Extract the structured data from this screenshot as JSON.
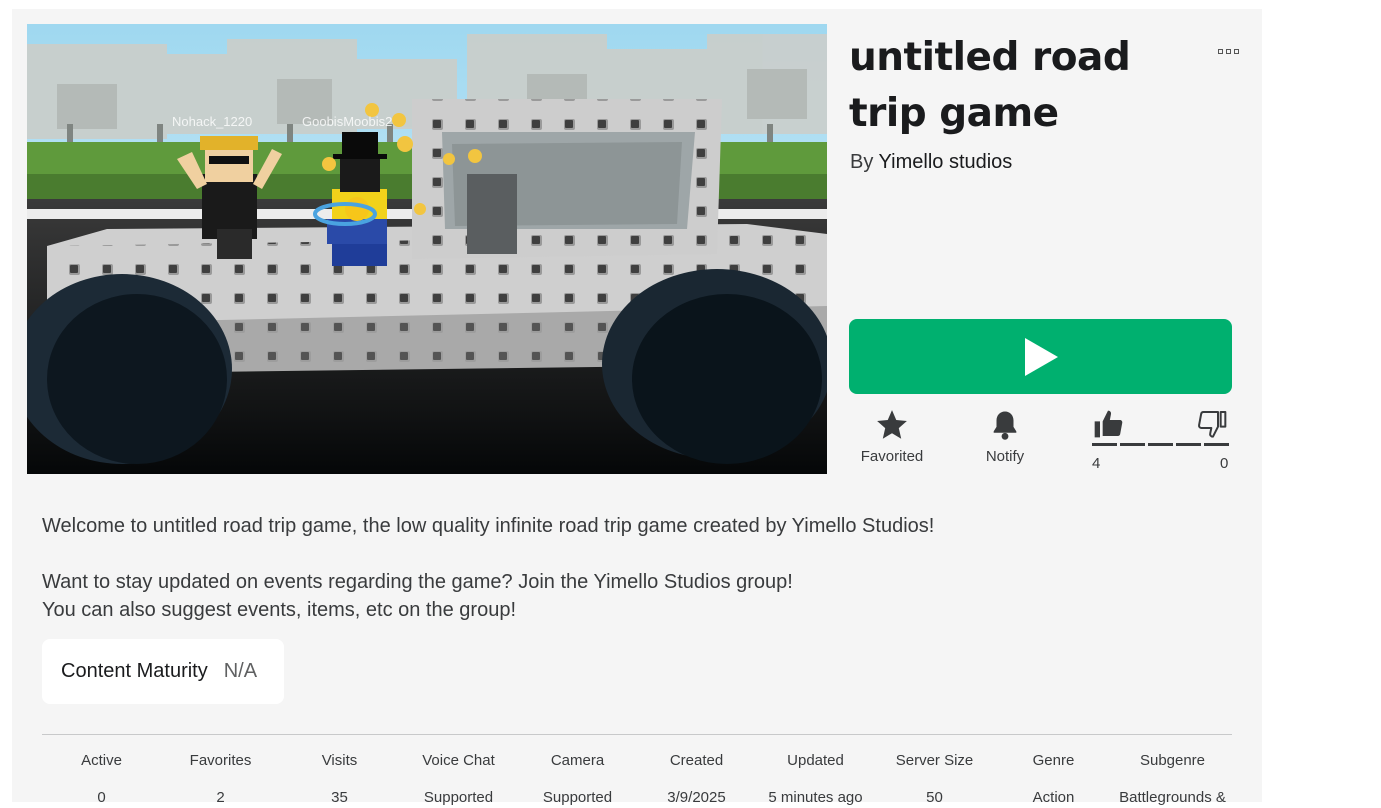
{
  "game": {
    "title": "untitled road trip game",
    "by_prefix": "By",
    "creator": "Yimello studios",
    "thumbnail_player_names": [
      "Nohack_1220",
      "GoobisMoobis2"
    ]
  },
  "actions": {
    "favorite_label": "Favorited",
    "notify_label": "Notify",
    "upvotes": "4",
    "downvotes": "0"
  },
  "description": {
    "line1": "Welcome to untitled road trip game, the low quality infinite road trip game created by Yimello Studios!",
    "line2": "Want to stay updated on events regarding the game? Join the Yimello Studios group!",
    "line3": "You can also suggest events, items, etc on the group!"
  },
  "maturity": {
    "label": "Content Maturity",
    "value": "N/A"
  },
  "stats": [
    {
      "label": "Active",
      "value": "0"
    },
    {
      "label": "Favorites",
      "value": "2"
    },
    {
      "label": "Visits",
      "value": "35"
    },
    {
      "label": "Voice Chat",
      "value": "Supported"
    },
    {
      "label": "Camera",
      "value": "Supported"
    },
    {
      "label": "Created",
      "value": "3/9/2025"
    },
    {
      "label": "Updated",
      "value": "5 minutes ago"
    },
    {
      "label": "Server Size",
      "value": "50"
    },
    {
      "label": "Genre",
      "value": "Action"
    },
    {
      "label": "Subgenre",
      "value": "Battlegrounds &"
    }
  ],
  "colors": {
    "play_button": "#00b06f",
    "panel_bg": "#f5f5f5"
  },
  "icons": [
    "more-options-icon",
    "play-icon",
    "star-icon",
    "bell-icon",
    "thumbs-up-icon",
    "thumbs-down-icon"
  ]
}
